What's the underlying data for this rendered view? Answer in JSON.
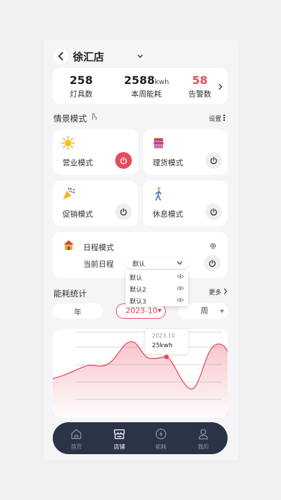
{
  "header": {
    "store_name": "徐汇店"
  },
  "stats": [
    {
      "value": "258",
      "unit": "",
      "label": "灯具数"
    },
    {
      "value": "2588",
      "unit": "kwh",
      "label": "本周能耗"
    },
    {
      "value": "58",
      "unit": "",
      "label": "告警数"
    }
  ],
  "scene": {
    "title": "情景模式",
    "settings_label": "设置",
    "modes": [
      {
        "label": "营业模式",
        "on": true,
        "icon": "sun-icon"
      },
      {
        "label": "理货模式",
        "on": false,
        "icon": "books-icon"
      },
      {
        "label": "促销模式",
        "on": false,
        "icon": "party-popper-icon"
      },
      {
        "label": "休息模式",
        "on": false,
        "icon": "walking-person-icon"
      }
    ],
    "schedule": {
      "title": "日程模式",
      "current_label": "当前日程",
      "selected": "默认",
      "options": [
        "默认",
        "默认2",
        "默认3"
      ]
    }
  },
  "energy": {
    "title": "能耗统计",
    "more_label": "更多",
    "filters": {
      "year": "年",
      "month": "2023-10",
      "week": "周"
    },
    "tooltip": {
      "date": "2023.10",
      "value": "25kwh"
    }
  },
  "nav": [
    {
      "label": "首页",
      "active": false
    },
    {
      "label": "店铺",
      "active": true
    },
    {
      "label": "能耗",
      "active": false
    },
    {
      "label": "我的",
      "active": false
    }
  ],
  "colors": {
    "accent": "#e64b5c",
    "nav_bg": "#2b3447",
    "card_bg": "#ffffff"
  }
}
